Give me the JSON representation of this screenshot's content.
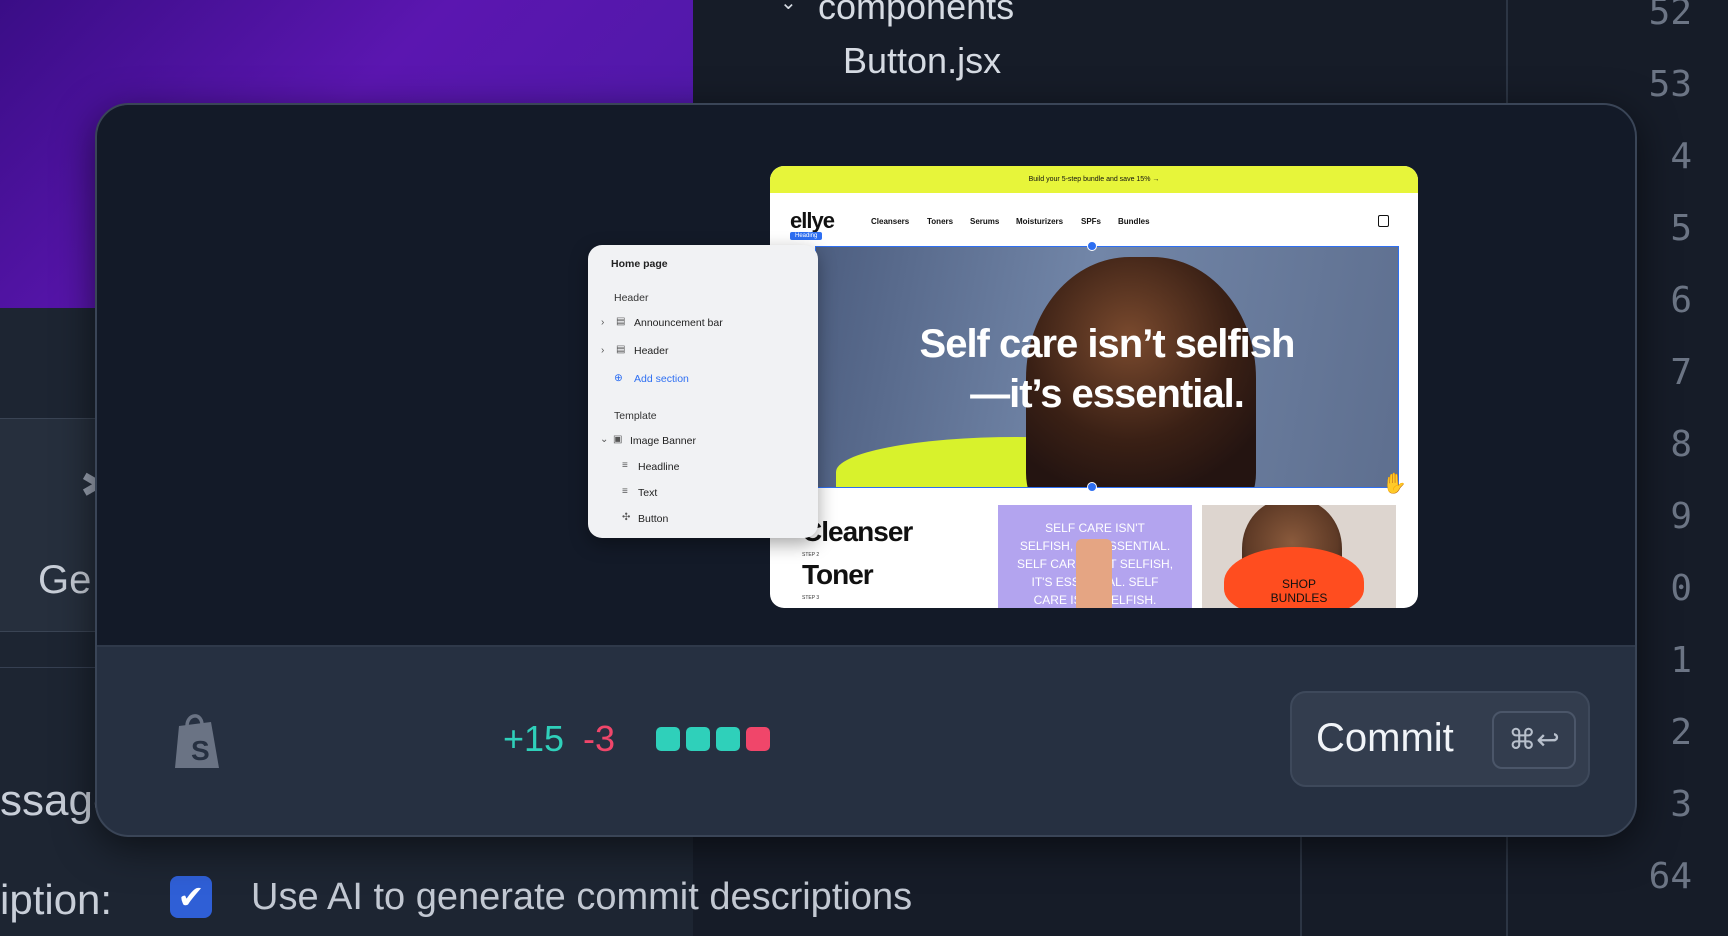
{
  "background": {
    "file_tree": {
      "folder": "components",
      "file": "Button.jsx"
    },
    "line_numbers": [
      "52",
      "53",
      "4",
      "5",
      "6",
      "7",
      "8",
      "9",
      "0",
      "1",
      "2",
      "3",
      "64"
    ],
    "left_panel": {
      "card_label": "Ge",
      "message_label": "ssage",
      "description_label": "iption:",
      "ai_checkbox_label": "Use AI to generate commit descriptions",
      "ai_checkbox_checked": true
    }
  },
  "preview": {
    "site": {
      "announcement": "Build your 5-step bundle and save 15% →",
      "logo": "ellye",
      "nav": [
        "Cleansers",
        "Toners",
        "Serums",
        "Moisturizers",
        "SPFs",
        "Bundles"
      ],
      "heading_tag": "Heading",
      "hero_headline": [
        "Self care isn’t selfish",
        "—it’s essential."
      ],
      "products": [
        {
          "name": "Cleanser",
          "step": "STEP 2"
        },
        {
          "name": "Toner",
          "step": "STEP 3"
        }
      ],
      "tile_text": [
        "SELF CARE ISN'T",
        "SELFISH, IT'S ESSENTIAL.",
        "SELF CARE ISN'T SELFISH,",
        "IT'S ESSENTIAL. SELF",
        "CARE ISN'T SELFISH."
      ],
      "bundle_cta": [
        "SHOP",
        "BUNDLES"
      ]
    },
    "editor": {
      "title": "Home page",
      "header_section": "Header",
      "header_items": [
        "Announcement bar",
        "Header"
      ],
      "add_section": "Add section",
      "template_section": "Template",
      "template_block": "Image Banner",
      "template_children": [
        "Headline",
        "Text",
        "Button"
      ]
    }
  },
  "footer": {
    "logo_icon": "shopify-bag-icon",
    "additions": "+15",
    "deletions": "-3",
    "diff_squares": [
      "#2fd0ba",
      "#2fd0ba",
      "#2fd0ba",
      "#f0466a"
    ],
    "commit_label": "Commit",
    "commit_shortcut": "⌘↩"
  }
}
